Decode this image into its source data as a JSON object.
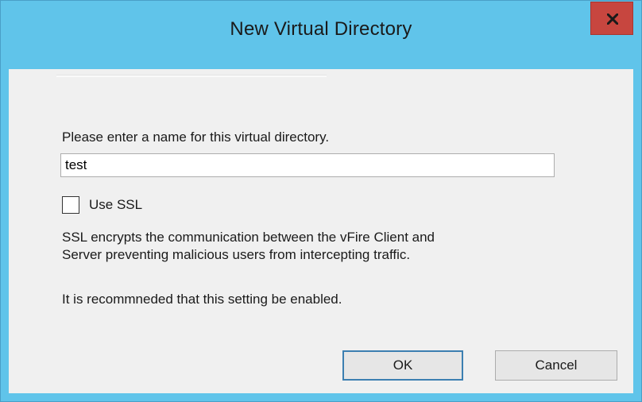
{
  "window": {
    "title": "New Virtual Directory",
    "close_glyph": "x",
    "accent_color": "#60c4ea",
    "close_color": "#c7463f"
  },
  "form": {
    "prompt": "Please enter a name for this virtual directory.",
    "name_value": "test",
    "use_ssl_label": "Use SSL",
    "use_ssl_checked": false,
    "description_line1": "SSL encrypts the communication between the vFire Client and",
    "description_line2": "Server preventing malicious users from intercepting traffic.",
    "recommendation": "It is recommneded that this setting be enabled."
  },
  "buttons": {
    "ok_label": "OK",
    "cancel_label": "Cancel"
  },
  "icons": {
    "close": "close-icon"
  }
}
